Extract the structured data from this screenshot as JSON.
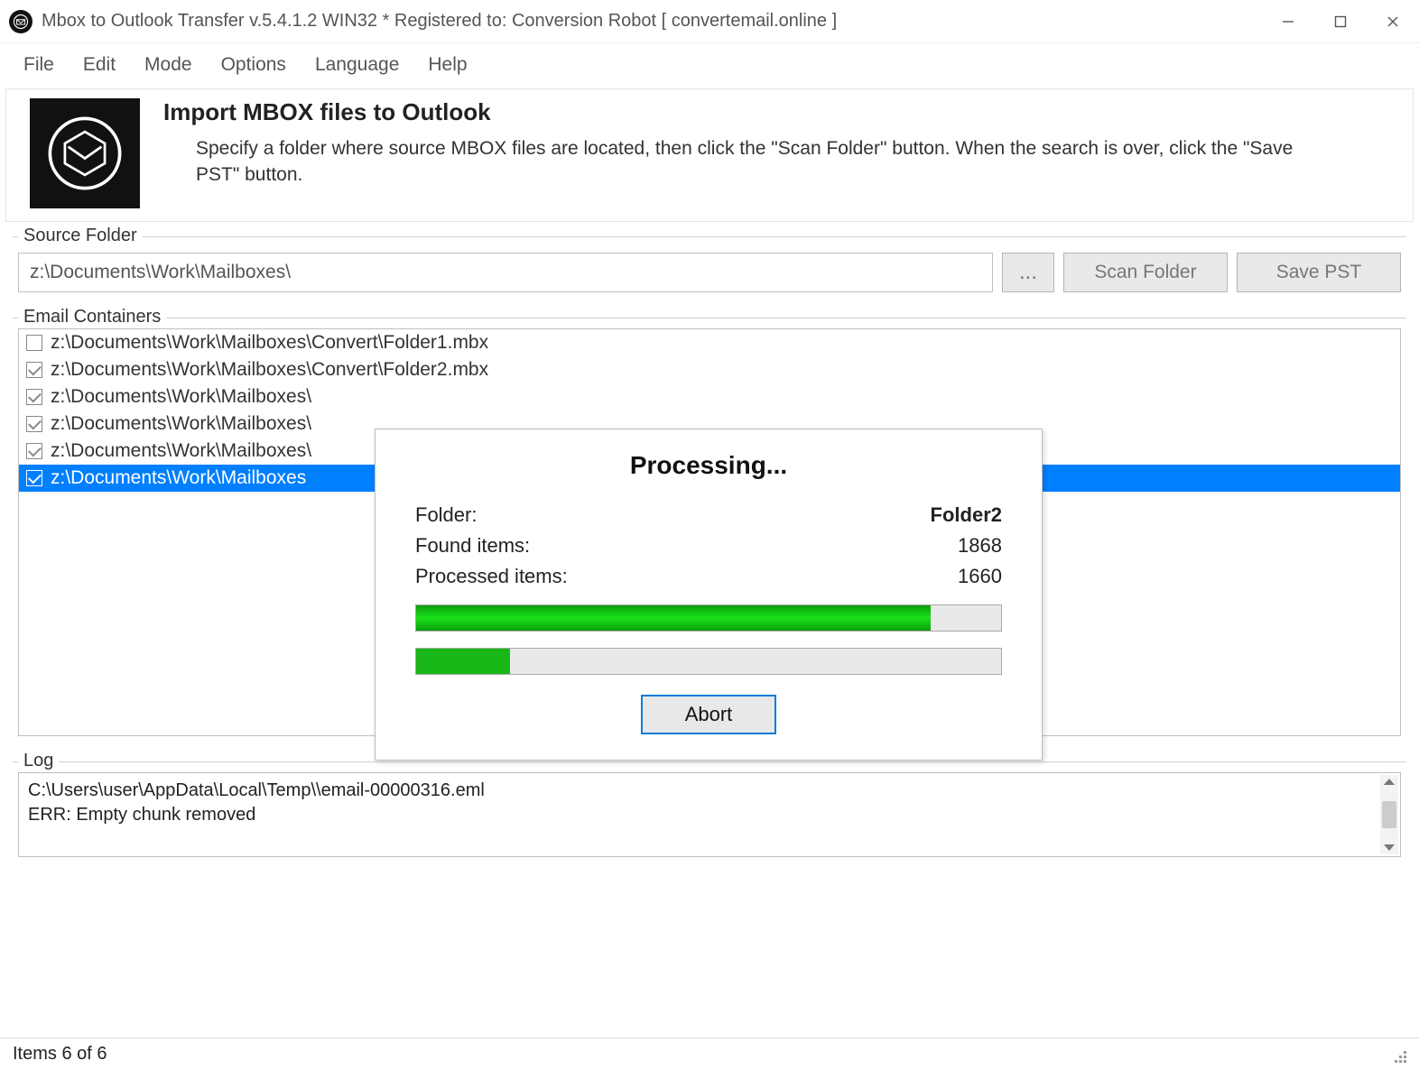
{
  "titlebar": {
    "title": "Mbox to Outlook Transfer v.5.4.1.2 WIN32 * Registered to: Conversion Robot [ convertemail.online ]"
  },
  "menu": {
    "items": [
      "File",
      "Edit",
      "Mode",
      "Options",
      "Language",
      "Help"
    ]
  },
  "header": {
    "title": "Import MBOX files to Outlook",
    "desc": "Specify a folder where source MBOX files are located, then click the \"Scan Folder\" button. When the search is over, click the \"Save PST\" button."
  },
  "source_folder": {
    "legend": "Source Folder",
    "path": "z:\\Documents\\Work\\Mailboxes\\",
    "browse": "...",
    "scan": "Scan Folder",
    "save": "Save PST"
  },
  "containers": {
    "legend": "Email Containers",
    "items": [
      {
        "checked": false,
        "selected": false,
        "path": "z:\\Documents\\Work\\Mailboxes\\Convert\\Folder1.mbx"
      },
      {
        "checked": true,
        "selected": false,
        "path": "z:\\Documents\\Work\\Mailboxes\\Convert\\Folder2.mbx"
      },
      {
        "checked": true,
        "selected": false,
        "path": "z:\\Documents\\Work\\Mailboxes\\"
      },
      {
        "checked": true,
        "selected": false,
        "path": "z:\\Documents\\Work\\Mailboxes\\"
      },
      {
        "checked": true,
        "selected": false,
        "path": "z:\\Documents\\Work\\Mailboxes\\"
      },
      {
        "checked": true,
        "selected": true,
        "path": "z:\\Documents\\Work\\Mailboxes"
      }
    ]
  },
  "dialog": {
    "title": "Processing...",
    "folder_label": "Folder:",
    "folder_value": "Folder2",
    "found_label": "Found items:",
    "found_value": "1868",
    "processed_label": "Processed items:",
    "processed_value": "1660",
    "progress1_pct": 88,
    "progress2_pct": 16,
    "abort": "Abort"
  },
  "log": {
    "legend": "Log",
    "line1": "C:\\Users\\user\\AppData\\Local\\Temp\\\\email-00000316.eml",
    "line2": "ERR: Empty chunk removed"
  },
  "statusbar": {
    "text": "Items 6 of 6"
  }
}
